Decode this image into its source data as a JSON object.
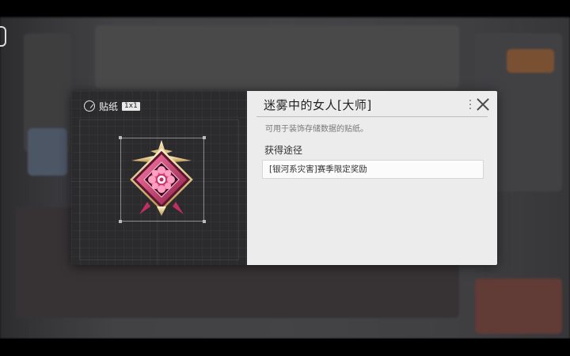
{
  "sticker": {
    "category_label": "贴纸",
    "size_badge": "1x1",
    "category_icon": "sticker-icon"
  },
  "detail": {
    "title": "迷雾中的女人[大师]",
    "description": "可用于装饰存储数据的贴纸。",
    "source_heading": "获得途径",
    "sources": [
      "[银河系灾害]赛季限定奖励"
    ]
  },
  "colors": {
    "emblem_pink": "#d0406e",
    "emblem_gold": "#e8c98a",
    "panel_dark": "#2b2b2d",
    "panel_light": "#ececec"
  }
}
